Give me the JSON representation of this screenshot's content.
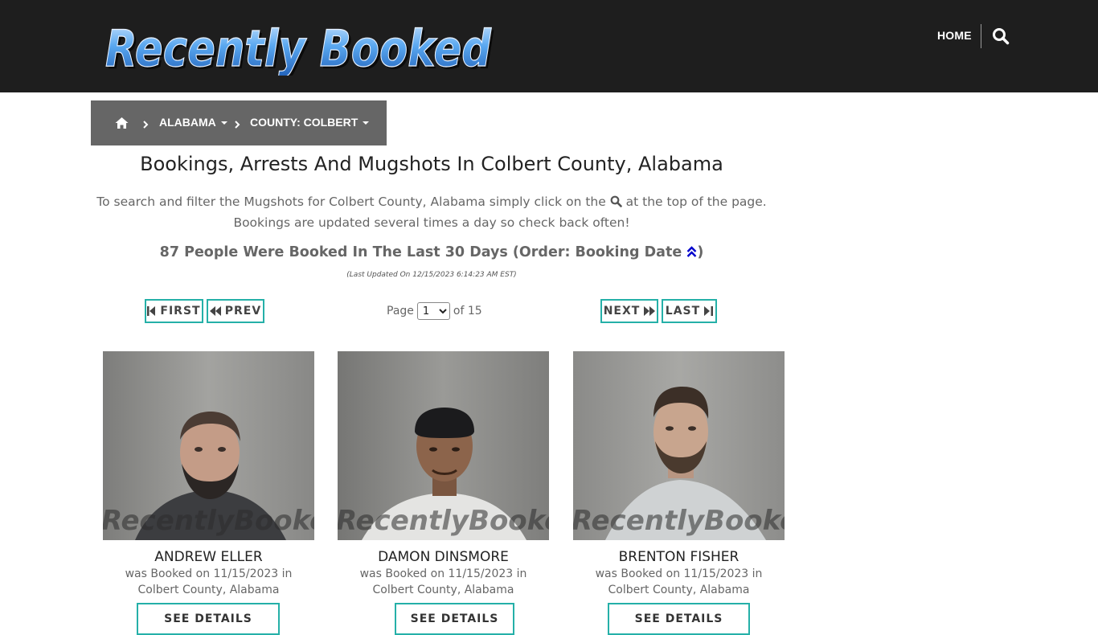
{
  "header": {
    "logo_text": "Recently Booked",
    "nav_home": "HOME",
    "search_icon": "search-icon"
  },
  "breadcrumb": {
    "home_icon": "home-icon",
    "state": "ALABAMA",
    "county": "COUNTY: COLBERT"
  },
  "main": {
    "title": "Bookings, Arrests And Mugshots In Colbert County, Alabama",
    "intro_part1": "To search and filter the Mugshots for Colbert County, Alabama simply click on the",
    "intro_part2": "at the top of the page.",
    "intro_line2": "Bookings are updated several times a day so check back often!",
    "count_text": "87 People Were Booked In The Last 30 Days (Order: Booking Date",
    "count_close": ")",
    "last_updated": "(Last Updated On 12/15/2023 6:14:23 AM EST)"
  },
  "pagination": {
    "first_label": "FIRST",
    "prev_label": "PREV",
    "next_label": "NEXT",
    "last_label": "LAST",
    "page_label": "Page",
    "page_value": "1",
    "of_label": "of 15"
  },
  "people": [
    {
      "name": "ANDREW ELLER",
      "booked_text": "was Booked on 11/15/2023 in",
      "location": "Colbert County, Alabama",
      "button": "SEE DETAILS",
      "watermark": "RecentlyBooked.com"
    },
    {
      "name": "DAMON DINSMORE",
      "booked_text": "was Booked on 11/15/2023 in",
      "location": "Colbert County, Alabama",
      "button": "SEE DETAILS",
      "watermark": "RecentlyBooked.com"
    },
    {
      "name": "BRENTON FISHER",
      "booked_text": "was Booked on 11/15/2023 in",
      "location": "Colbert County, Alabama",
      "button": "SEE DETAILS",
      "watermark": "RecentlyBooked.com"
    }
  ],
  "colors": {
    "topbar": "#1e1e1e",
    "breadcrumb": "#666666",
    "accent": "#25b0a8",
    "sort_icon": "#0000cc"
  }
}
